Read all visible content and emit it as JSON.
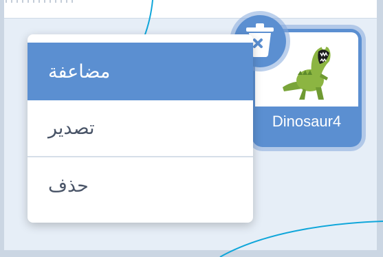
{
  "context_menu": {
    "items": [
      {
        "label": "مضاعفة",
        "active": true
      },
      {
        "label": "تصدير",
        "active": false
      },
      {
        "label": "حذف",
        "active": false
      }
    ]
  },
  "sprite": {
    "name": "Dinosaur4",
    "thumbnail_icon": "dinosaur-icon"
  },
  "delete_button": {
    "icon": "trash-icon"
  },
  "colors": {
    "accent": "#5b8fd1",
    "stage_bg": "#e6eef7",
    "menu_text": "#4a5568"
  }
}
